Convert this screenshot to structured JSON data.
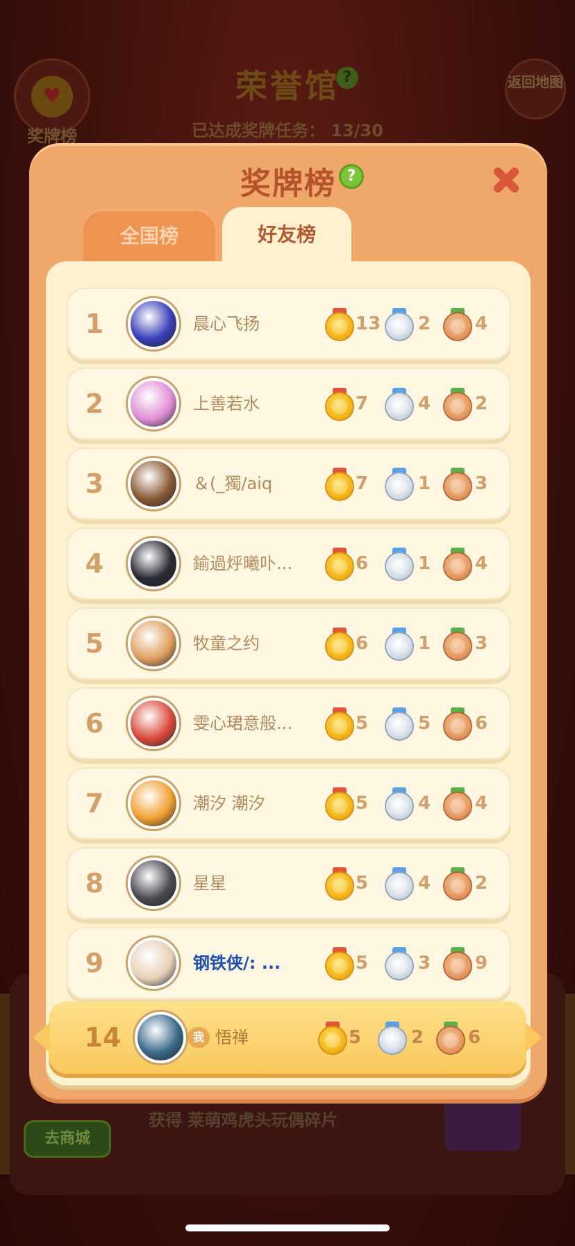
{
  "background": {
    "title": "荣誉馆",
    "progress_label": "已达成奖牌任务：",
    "progress_value": "13/30",
    "medal_button_label": "奖牌榜",
    "back_button_label": "返回地图",
    "shop_button_label": "去商城",
    "reward_text": "获得 莱萌鸡虎头玩偶碎片"
  },
  "modal": {
    "title": "奖牌榜",
    "help_glyph": "?",
    "tabs": [
      {
        "label": "全国榜",
        "active": false
      },
      {
        "label": "好友榜",
        "active": true
      }
    ]
  },
  "leaderboard": [
    {
      "rank": "1",
      "name": "晨心飞扬",
      "gold": "13",
      "silver": "2",
      "bronze": "4",
      "avatar_color": "#3a3fb8"
    },
    {
      "rank": "2",
      "name": "上善若水",
      "gold": "7",
      "silver": "4",
      "bronze": "2",
      "avatar_color": "#e08fd6"
    },
    {
      "rank": "3",
      "name": "＆(_獨/aiq",
      "gold": "7",
      "silver": "1",
      "bronze": "3",
      "avatar_color": "#8a5a34"
    },
    {
      "rank": "4",
      "name": "鍮過烀曦卟...",
      "gold": "6",
      "silver": "1",
      "bronze": "4",
      "avatar_color": "#2a2a34"
    },
    {
      "rank": "5",
      "name": "牧童之约",
      "gold": "6",
      "silver": "1",
      "bronze": "3",
      "avatar_color": "#e0a060"
    },
    {
      "rank": "6",
      "name": "雯心珺意般...",
      "gold": "5",
      "silver": "5",
      "bronze": "6",
      "avatar_color": "#d94a3a"
    },
    {
      "rank": "7",
      "name": "潮汐 潮汐",
      "gold": "5",
      "silver": "4",
      "bronze": "4",
      "avatar_color": "#f0a030"
    },
    {
      "rank": "8",
      "name": "星星",
      "gold": "5",
      "silver": "4",
      "bronze": "2",
      "avatar_color": "#4a4a50"
    },
    {
      "rank": "9",
      "name": "钢铁侠/:  ...",
      "gold": "5",
      "silver": "3",
      "bronze": "9",
      "avatar_color": "#e8d0b8"
    }
  ],
  "my_entry": {
    "rank": "14",
    "me_badge": "我",
    "name": "悟禅",
    "gold": "5",
    "silver": "2",
    "bronze": "6",
    "avatar_color": "#3a6a8a"
  },
  "colors": {
    "modal_bg": "#f0a76a",
    "content_bg": "#fdf1cf",
    "row_bg": "#fff7e1",
    "title_color": "#b5542b",
    "my_row_bg": "#f8c95c"
  }
}
